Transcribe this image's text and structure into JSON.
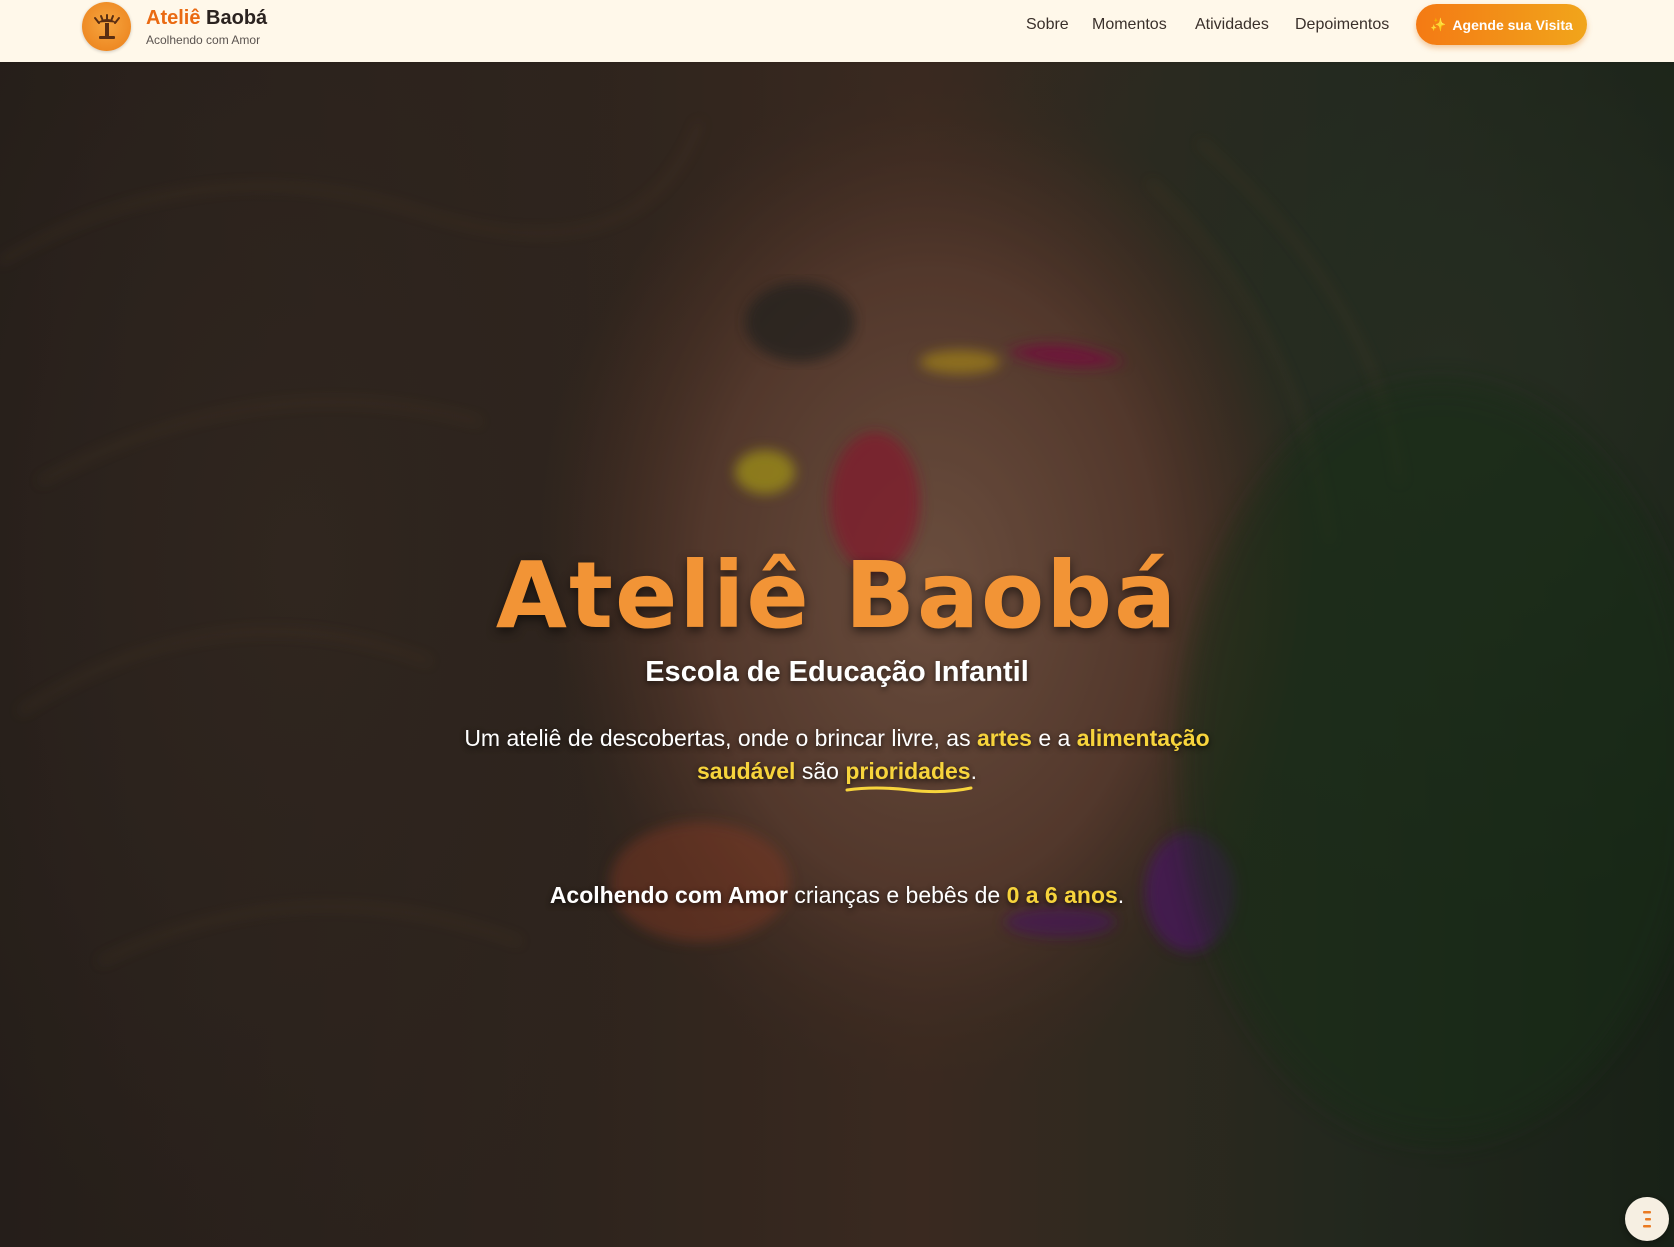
{
  "header": {
    "brand": {
      "name_part1": "Ateliê",
      "name_part2": "Baobá",
      "tagline": "Acolhendo com Amor",
      "logo_icon": "baobab-tree-icon"
    },
    "nav": [
      {
        "label": "Sobre"
      },
      {
        "label": "Momentos"
      },
      {
        "label": "Atividades"
      },
      {
        "label": "Depoimentos"
      }
    ],
    "cta": {
      "icon": "sparkles-icon",
      "icon_glyph": "✨",
      "label": "Agende sua Visita"
    }
  },
  "hero": {
    "title": "Ateliê Baobá",
    "subtitle": "Escola de Educação Infantil",
    "description": {
      "t1": "Um ateliê de descobertas, onde o brincar livre, as",
      "h1": "artes",
      "t2": "e a",
      "h2": "alimentação saudável",
      "t3": "são",
      "h3": "prioridades",
      "t4": "."
    },
    "tagline": {
      "strong": "Acolhendo com Amor",
      "t1": "crianças e bebês de",
      "highlight": "0 a 6 anos",
      "t2": "."
    }
  },
  "floating_menu": {
    "icon": "menu-icon"
  },
  "colors": {
    "header_bg": "#fff8ea",
    "brand_orange": "#ea6a12",
    "title_orange": "#f29436",
    "highlight_yellow": "#f7d43c",
    "cta_gradient_start": "#f47a14",
    "cta_gradient_end": "#f1a51b"
  }
}
